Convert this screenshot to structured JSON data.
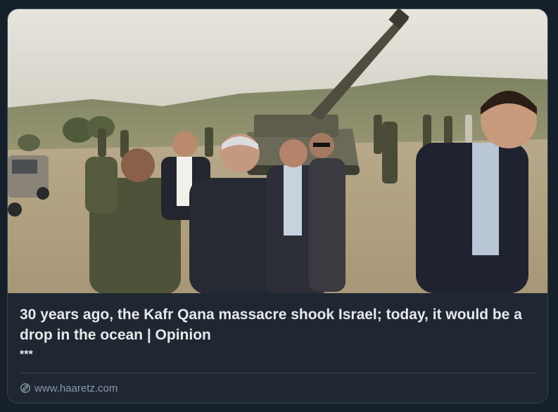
{
  "card": {
    "title": "30 years ago, the Kafr Qana massacre shook Israel; today, it would be a drop in the ocean | Opinion",
    "description": "***",
    "source_domain": "www.haaretz.com",
    "source_icon": "link-icon"
  },
  "image": {
    "alt": "News photo: group of men in suits and soldiers walking in a field with a tank behind them"
  },
  "colors": {
    "background": "#15202b",
    "card_background": "#1e2732",
    "border": "#38444d",
    "title_text": "#e7e9ea",
    "muted_text": "#8b98a5"
  }
}
